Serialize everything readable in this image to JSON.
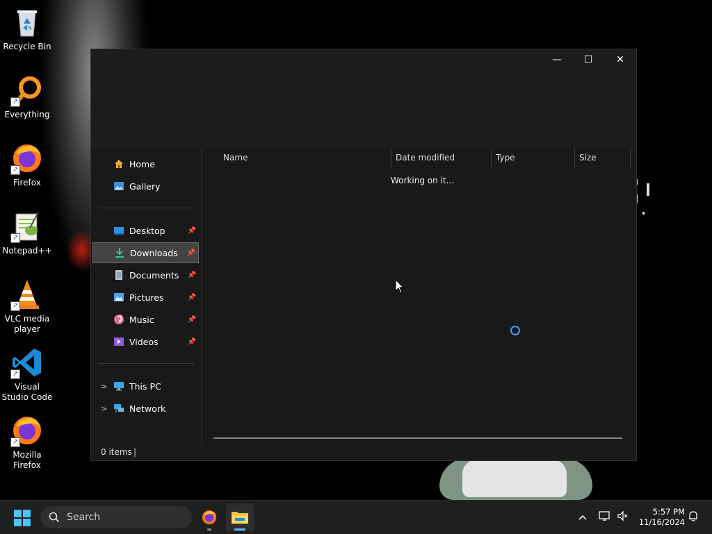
{
  "desktop": {
    "icons": [
      {
        "label": "Recycle Bin"
      },
      {
        "label": "Everything"
      },
      {
        "label": "Firefox"
      },
      {
        "label": "Notepad++"
      },
      {
        "label": "VLC media player"
      },
      {
        "label": "Visual Studio Code"
      },
      {
        "label": "Mozilla Firefox"
      }
    ]
  },
  "window": {
    "controls": {
      "minimize": "—",
      "maximize": "☐",
      "close": "✕"
    },
    "nav": {
      "home": "Home",
      "gallery": "Gallery",
      "desktop": "Desktop",
      "downloads": "Downloads",
      "documents": "Documents",
      "pictures": "Pictures",
      "music": "Music",
      "videos": "Videos",
      "this_pc": "This PC",
      "network": "Network"
    },
    "columns": [
      "Name",
      "Date modified",
      "Type",
      "Size"
    ],
    "loading_text": "Working on it...",
    "status": {
      "items": "0 items"
    }
  },
  "taskbar": {
    "search_placeholder": "Search",
    "time": "5:57 PM",
    "date": "11/16/2024"
  },
  "colors": {
    "accent": "#4cc2ff",
    "window_bg": "#191919",
    "selected_bg": "#434343",
    "taskbar_bg": "#1f1f1f"
  }
}
